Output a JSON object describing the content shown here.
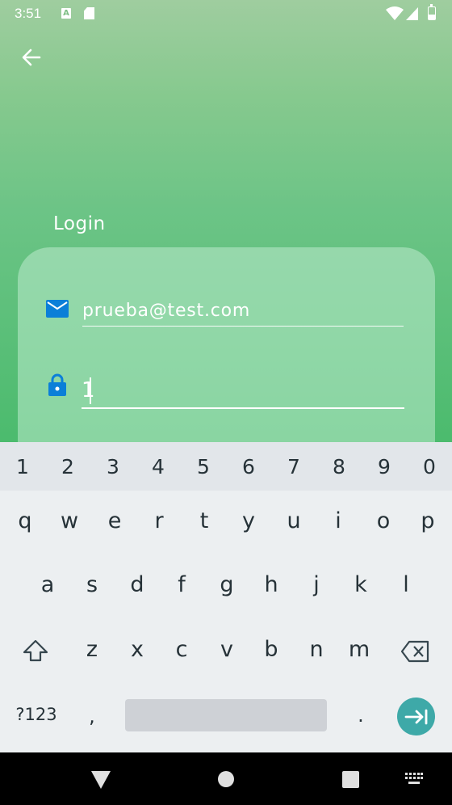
{
  "status_bar": {
    "time": "3:51",
    "icons": [
      "a-notification-icon",
      "sd-card-icon",
      "wifi-icon",
      "signal-icon",
      "battery-icon"
    ]
  },
  "app": {
    "back_icon": "arrow-back-icon",
    "login_title": "Login",
    "email": {
      "icon": "email-icon",
      "value": "prueba@test.com"
    },
    "password": {
      "icon": "lock-icon",
      "value": "1"
    },
    "colors": {
      "icon_blue": "#0b7fd8",
      "gradient_top": "#9fcd9f",
      "gradient_bottom": "#4cbb6e",
      "enter_key": "#3ea9a8"
    }
  },
  "keyboard": {
    "number_row": [
      "1",
      "2",
      "3",
      "4",
      "5",
      "6",
      "7",
      "8",
      "9",
      "0"
    ],
    "row1": [
      "q",
      "w",
      "e",
      "r",
      "t",
      "y",
      "u",
      "i",
      "o",
      "p"
    ],
    "row2": [
      "a",
      "s",
      "d",
      "f",
      "g",
      "h",
      "j",
      "k",
      "l"
    ],
    "row3": [
      "z",
      "x",
      "c",
      "v",
      "b",
      "n",
      "m"
    ],
    "symbols_key": "?123",
    "comma_key": ",",
    "period_key": "."
  }
}
